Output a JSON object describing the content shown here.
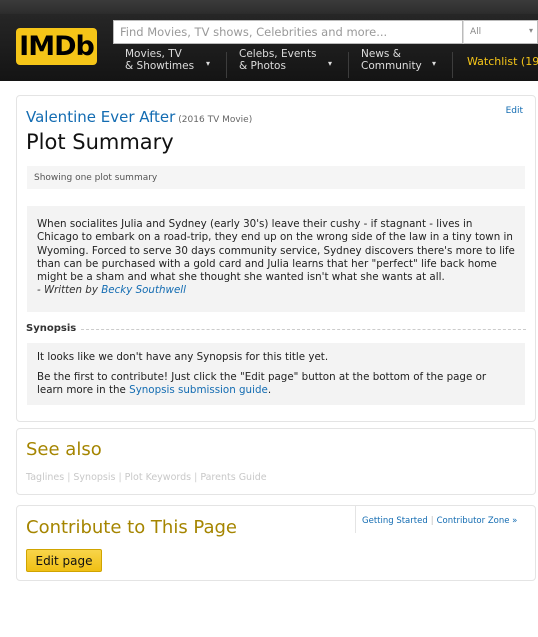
{
  "header": {
    "logo": "IMDb",
    "search": {
      "placeholder": "Find Movies, TV shows, Celebrities and more...",
      "category": "All"
    },
    "nav": [
      {
        "line1": "Movies, TV",
        "line2": "& Showtimes"
      },
      {
        "line1": "Celebs, Events",
        "line2": "& Photos"
      },
      {
        "line1": "News &",
        "line2": "Community"
      }
    ],
    "watchlist": "Watchlist (19"
  },
  "plot_card": {
    "title_link": "Valentine Ever After",
    "title_meta": "(2016 TV Movie)",
    "edit_label": "Edit",
    "page_title": "Plot Summary",
    "showing_text": "Showing one plot summary",
    "summary_text": "When socialites Julia and Sydney (early 30's) leave their cushy - if stagnant - lives in Chicago to embark on a road-trip, they end up on the wrong side of the law in a tiny town in Wyoming. Forced to serve 30 days community service, Sydney discovers there's more to life than can be purchased with a gold card and Julia learns that her \"perfect\" life back home might be a sham and what she thought she wanted isn't what she wants at all.",
    "written_by_prefix": "- Written by",
    "author": "Becky Southwell",
    "synopsis_heading": "Synopsis",
    "synopsis_line1": "It looks like we don't have any Synopsis for this title yet.",
    "synopsis_line2_prefix": "Be the first to contribute! Just click the \"Edit page\" button at the bottom of the page or learn more in the",
    "synopsis_guide_link": "Synopsis submission guide",
    "synopsis_line2_suffix": "."
  },
  "see_also": {
    "title": "See also",
    "links": [
      "Taglines",
      "Synopsis",
      "Plot Keywords",
      "Parents Guide"
    ],
    "separator": "|"
  },
  "contribute": {
    "title": "Contribute to This Page",
    "getting_started": "Getting Started",
    "separator": "|",
    "contributor_zone": "Contributor Zone »",
    "edit_button": "Edit page"
  },
  "colors": {
    "imdb_yellow": "#f5c518",
    "link_blue": "#136cb2",
    "heading_gold": "#a58500"
  }
}
